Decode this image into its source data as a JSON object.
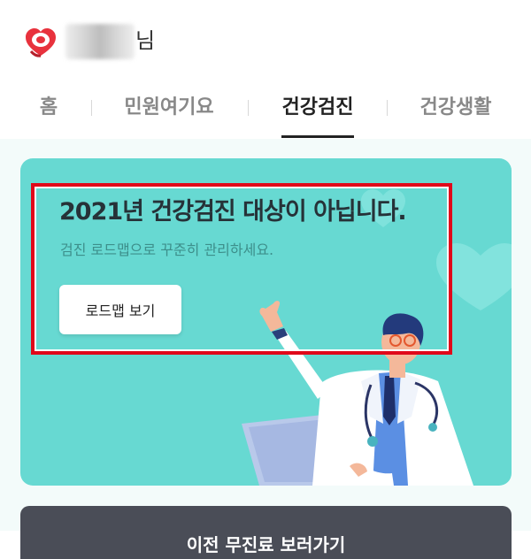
{
  "header": {
    "user_suffix": "님"
  },
  "tabs": [
    {
      "label": "홈"
    },
    {
      "label": "민원여기요"
    },
    {
      "label": "건강검진",
      "active": true
    },
    {
      "label": "건강생활"
    }
  ],
  "card": {
    "title": "2021년 건강검진 대상이 아닙니다.",
    "subtitle": "검진 로드맵으로 꾸준히 관리하세요.",
    "button_label": "로드맵 보기"
  },
  "bottom_button": {
    "label": "이전 무진료 보러가기"
  },
  "colors": {
    "card_background": "#67d9d2",
    "highlight_border": "#e0081a",
    "logo": "#e8323d",
    "bottom_button": "#4a4d57"
  },
  "icons": {
    "logo": "heart-logo-icon"
  }
}
